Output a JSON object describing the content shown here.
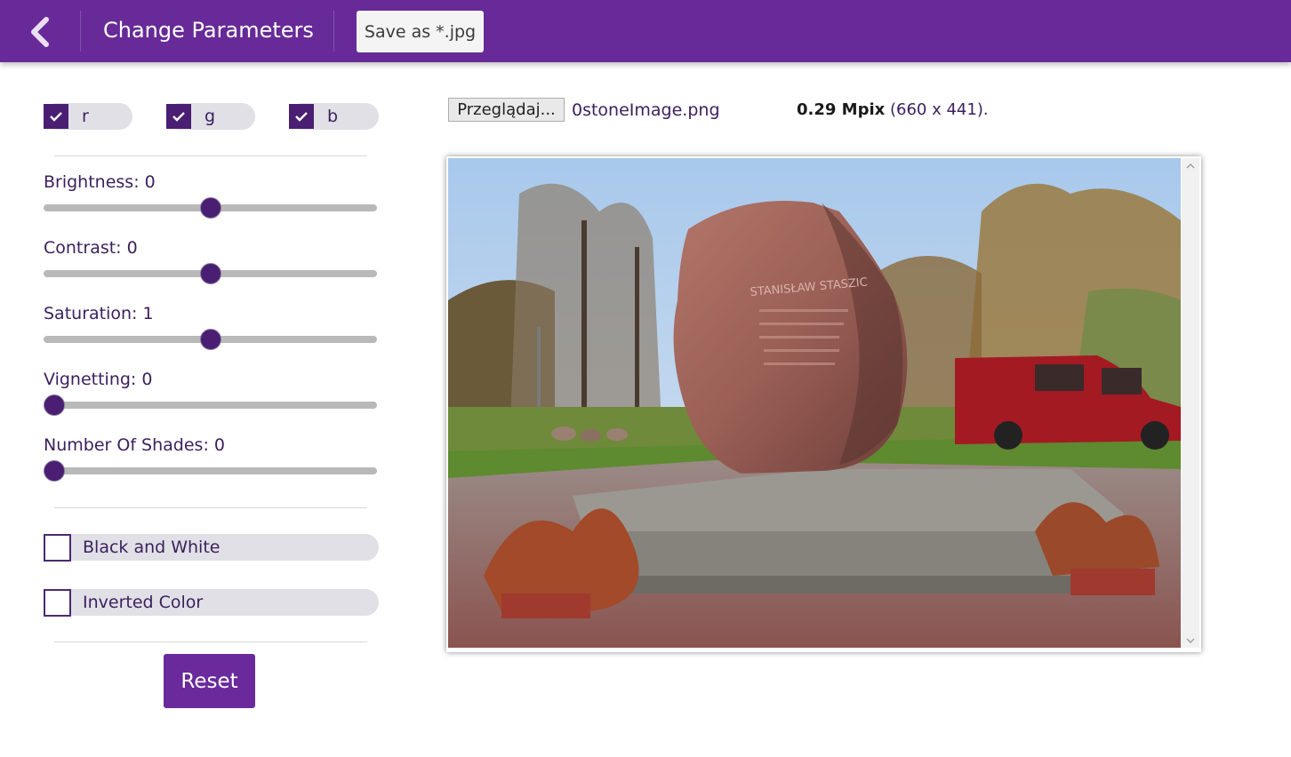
{
  "header": {
    "back_icon": "chevron-left-icon",
    "title": "Change Parameters",
    "save_label": "Save as *.jpg"
  },
  "channels": [
    {
      "label": "r",
      "checked": true
    },
    {
      "label": "g",
      "checked": true
    },
    {
      "label": "b",
      "checked": true
    }
  ],
  "sliders": {
    "brightness": {
      "label": "Brightness: 0",
      "value": 0,
      "position": 0.5
    },
    "contrast": {
      "label": "Contrast: 0",
      "value": 0,
      "position": 0.5
    },
    "saturation": {
      "label": "Saturation: 1",
      "value": 1,
      "position": 0.5
    },
    "vignetting": {
      "label": "Vignetting: 0",
      "value": 0,
      "position": 0.0
    },
    "shades": {
      "label": "Number Of Shades: 0",
      "value": 0,
      "position": 0.0
    }
  },
  "toggles": {
    "black_white": {
      "label": "Black and White",
      "checked": false
    },
    "inverted": {
      "label": "Inverted Color",
      "checked": false
    }
  },
  "reset_label": "Reset",
  "file": {
    "browse_label": "Przeglądaj...",
    "name": "0stoneImage.png",
    "mpix_bold": "0.29 Mpix",
    "dimensions": " (660 x 441)."
  },
  "colors": {
    "header_bg": "#672a98",
    "accent": "#4a1e73",
    "button": "#6a2a9c"
  },
  "image_text": "STANISŁAW STASZIC"
}
